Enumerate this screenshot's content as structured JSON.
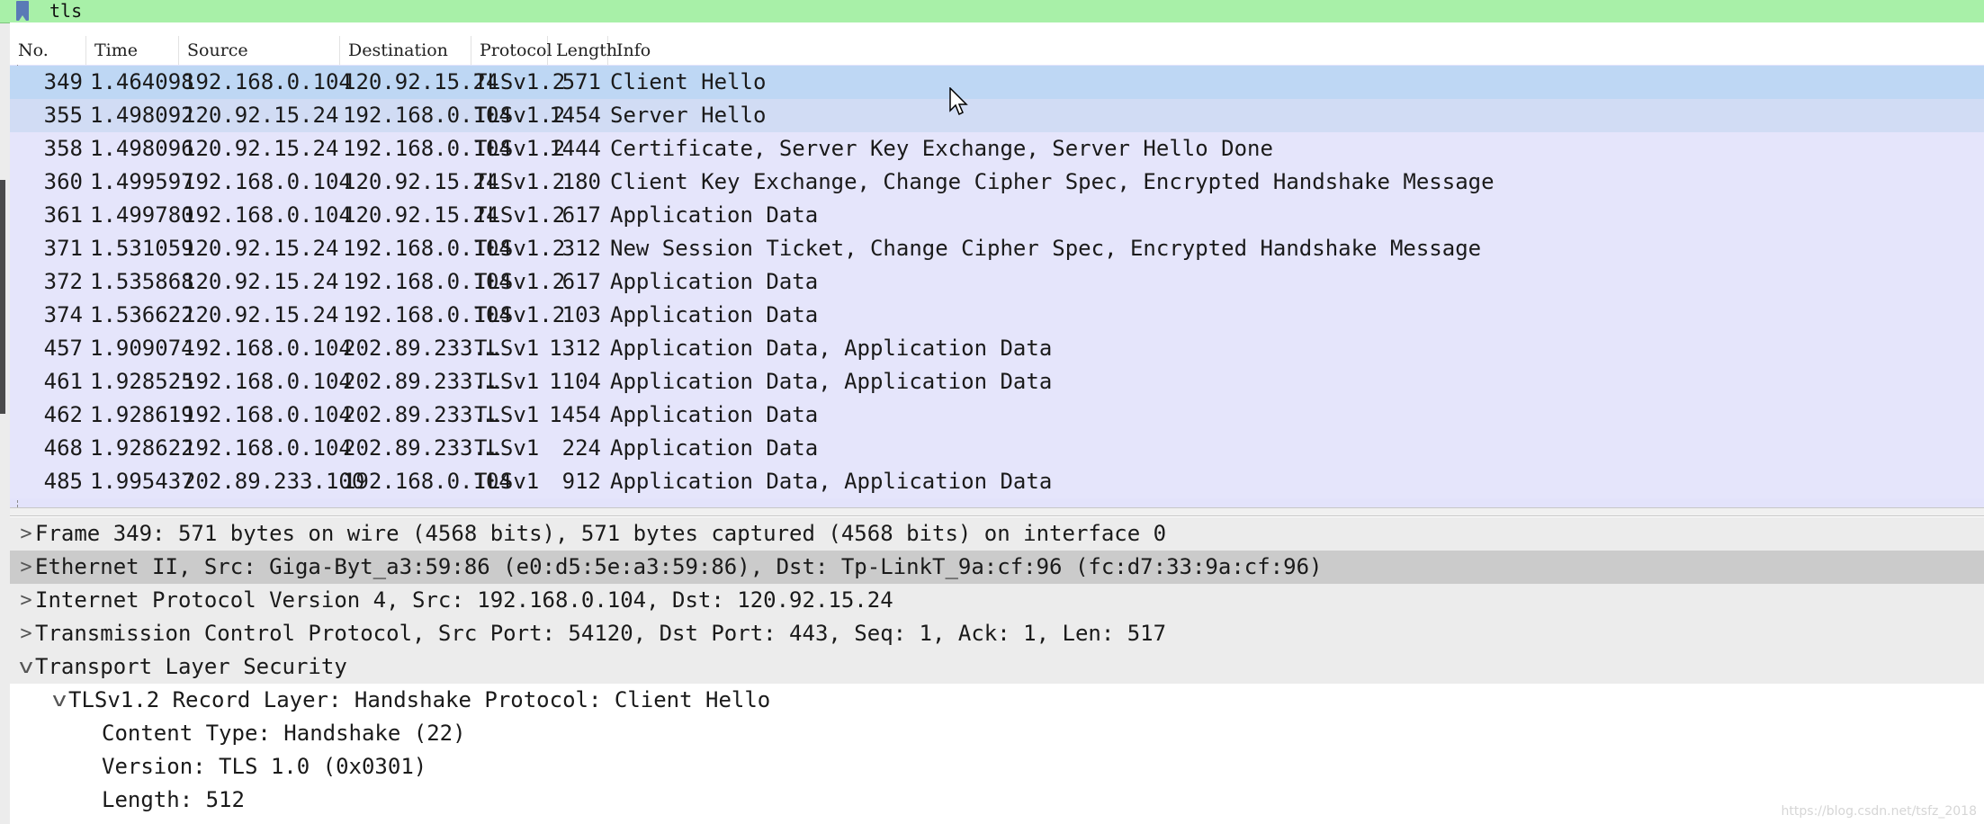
{
  "filter": {
    "value": "tls"
  },
  "columns": [
    "No.",
    "Time",
    "Source",
    "Destination",
    "Protocol",
    "Length",
    "Info"
  ],
  "packets": [
    {
      "no": "349",
      "time": "1.464098",
      "src": "192.168.0.104",
      "dst": "120.92.15.24",
      "proto": "TLSv1.2",
      "len": "571",
      "info": "Client Hello"
    },
    {
      "no": "355",
      "time": "1.498092",
      "src": "120.92.15.24",
      "dst": "192.168.0.104",
      "proto": "TLSv1.2",
      "len": "1454",
      "info": "Server Hello"
    },
    {
      "no": "358",
      "time": "1.498096",
      "src": "120.92.15.24",
      "dst": "192.168.0.104",
      "proto": "TLSv1.2",
      "len": "1444",
      "info": "Certificate, Server Key Exchange, Server Hello Done"
    },
    {
      "no": "360",
      "time": "1.499597",
      "src": "192.168.0.104",
      "dst": "120.92.15.24",
      "proto": "TLSv1.2",
      "len": "180",
      "info": "Client Key Exchange, Change Cipher Spec, Encrypted Handshake Message"
    },
    {
      "no": "361",
      "time": "1.499780",
      "src": "192.168.0.104",
      "dst": "120.92.15.24",
      "proto": "TLSv1.2",
      "len": "617",
      "info": "Application Data"
    },
    {
      "no": "371",
      "time": "1.531059",
      "src": "120.92.15.24",
      "dst": "192.168.0.104",
      "proto": "TLSv1.2",
      "len": "312",
      "info": "New Session Ticket, Change Cipher Spec, Encrypted Handshake Message"
    },
    {
      "no": "372",
      "time": "1.535868",
      "src": "120.92.15.24",
      "dst": "192.168.0.104",
      "proto": "TLSv1.2",
      "len": "617",
      "info": "Application Data"
    },
    {
      "no": "374",
      "time": "1.536622",
      "src": "120.92.15.24",
      "dst": "192.168.0.104",
      "proto": "TLSv1.2",
      "len": "103",
      "info": "Application Data"
    },
    {
      "no": "457",
      "time": "1.909074",
      "src": "192.168.0.104",
      "dst": "202.89.233.…",
      "proto": "TLSv1",
      "len": "1312",
      "info": "Application Data, Application Data"
    },
    {
      "no": "461",
      "time": "1.928525",
      "src": "192.168.0.104",
      "dst": "202.89.233.…",
      "proto": "TLSv1",
      "len": "1104",
      "info": "Application Data, Application Data"
    },
    {
      "no": "462",
      "time": "1.928619",
      "src": "192.168.0.104",
      "dst": "202.89.233.…",
      "proto": "TLSv1",
      "len": "1454",
      "info": "Application Data"
    },
    {
      "no": "468",
      "time": "1.928622",
      "src": "192.168.0.104",
      "dst": "202.89.233.…",
      "proto": "TLSv1",
      "len": "224",
      "info": "Application Data"
    },
    {
      "no": "485",
      "time": "1.995437",
      "src": "202.89.233.100",
      "dst": "192.168.0.104",
      "proto": "TLSv1",
      "len": "912",
      "info": "Application Data, Application Data"
    }
  ],
  "details": [
    {
      "arrow": ">",
      "indent": 0,
      "text": "Frame 349: 571 bytes on wire (4568 bits), 571 bytes captured (4568 bits) on interface 0"
    },
    {
      "arrow": ">",
      "indent": 0,
      "text": "Ethernet II, Src: Giga-Byt_a3:59:86 (e0:d5:5e:a3:59:86), Dst: Tp-LinkT_9a:cf:96 (fc:d7:33:9a:cf:96)"
    },
    {
      "arrow": ">",
      "indent": 0,
      "text": "Internet Protocol Version 4, Src: 192.168.0.104, Dst: 120.92.15.24"
    },
    {
      "arrow": ">",
      "indent": 0,
      "text": "Transmission Control Protocol, Src Port: 54120, Dst Port: 443, Seq: 1, Ack: 1, Len: 517"
    },
    {
      "arrow": "v",
      "indent": 0,
      "text": "Transport Layer Security"
    },
    {
      "arrow": "v",
      "indent": 1,
      "text": "TLSv1.2 Record Layer: Handshake Protocol: Client Hello"
    },
    {
      "arrow": "",
      "indent": 2,
      "text": "Content Type: Handshake (22)"
    },
    {
      "arrow": "",
      "indent": 2,
      "text": "Version: TLS 1.0 (0x0301)"
    },
    {
      "arrow": "",
      "indent": 2,
      "text": "Length: 512"
    }
  ],
  "watermark": "https://blog.csdn.net/tsfz_2018"
}
